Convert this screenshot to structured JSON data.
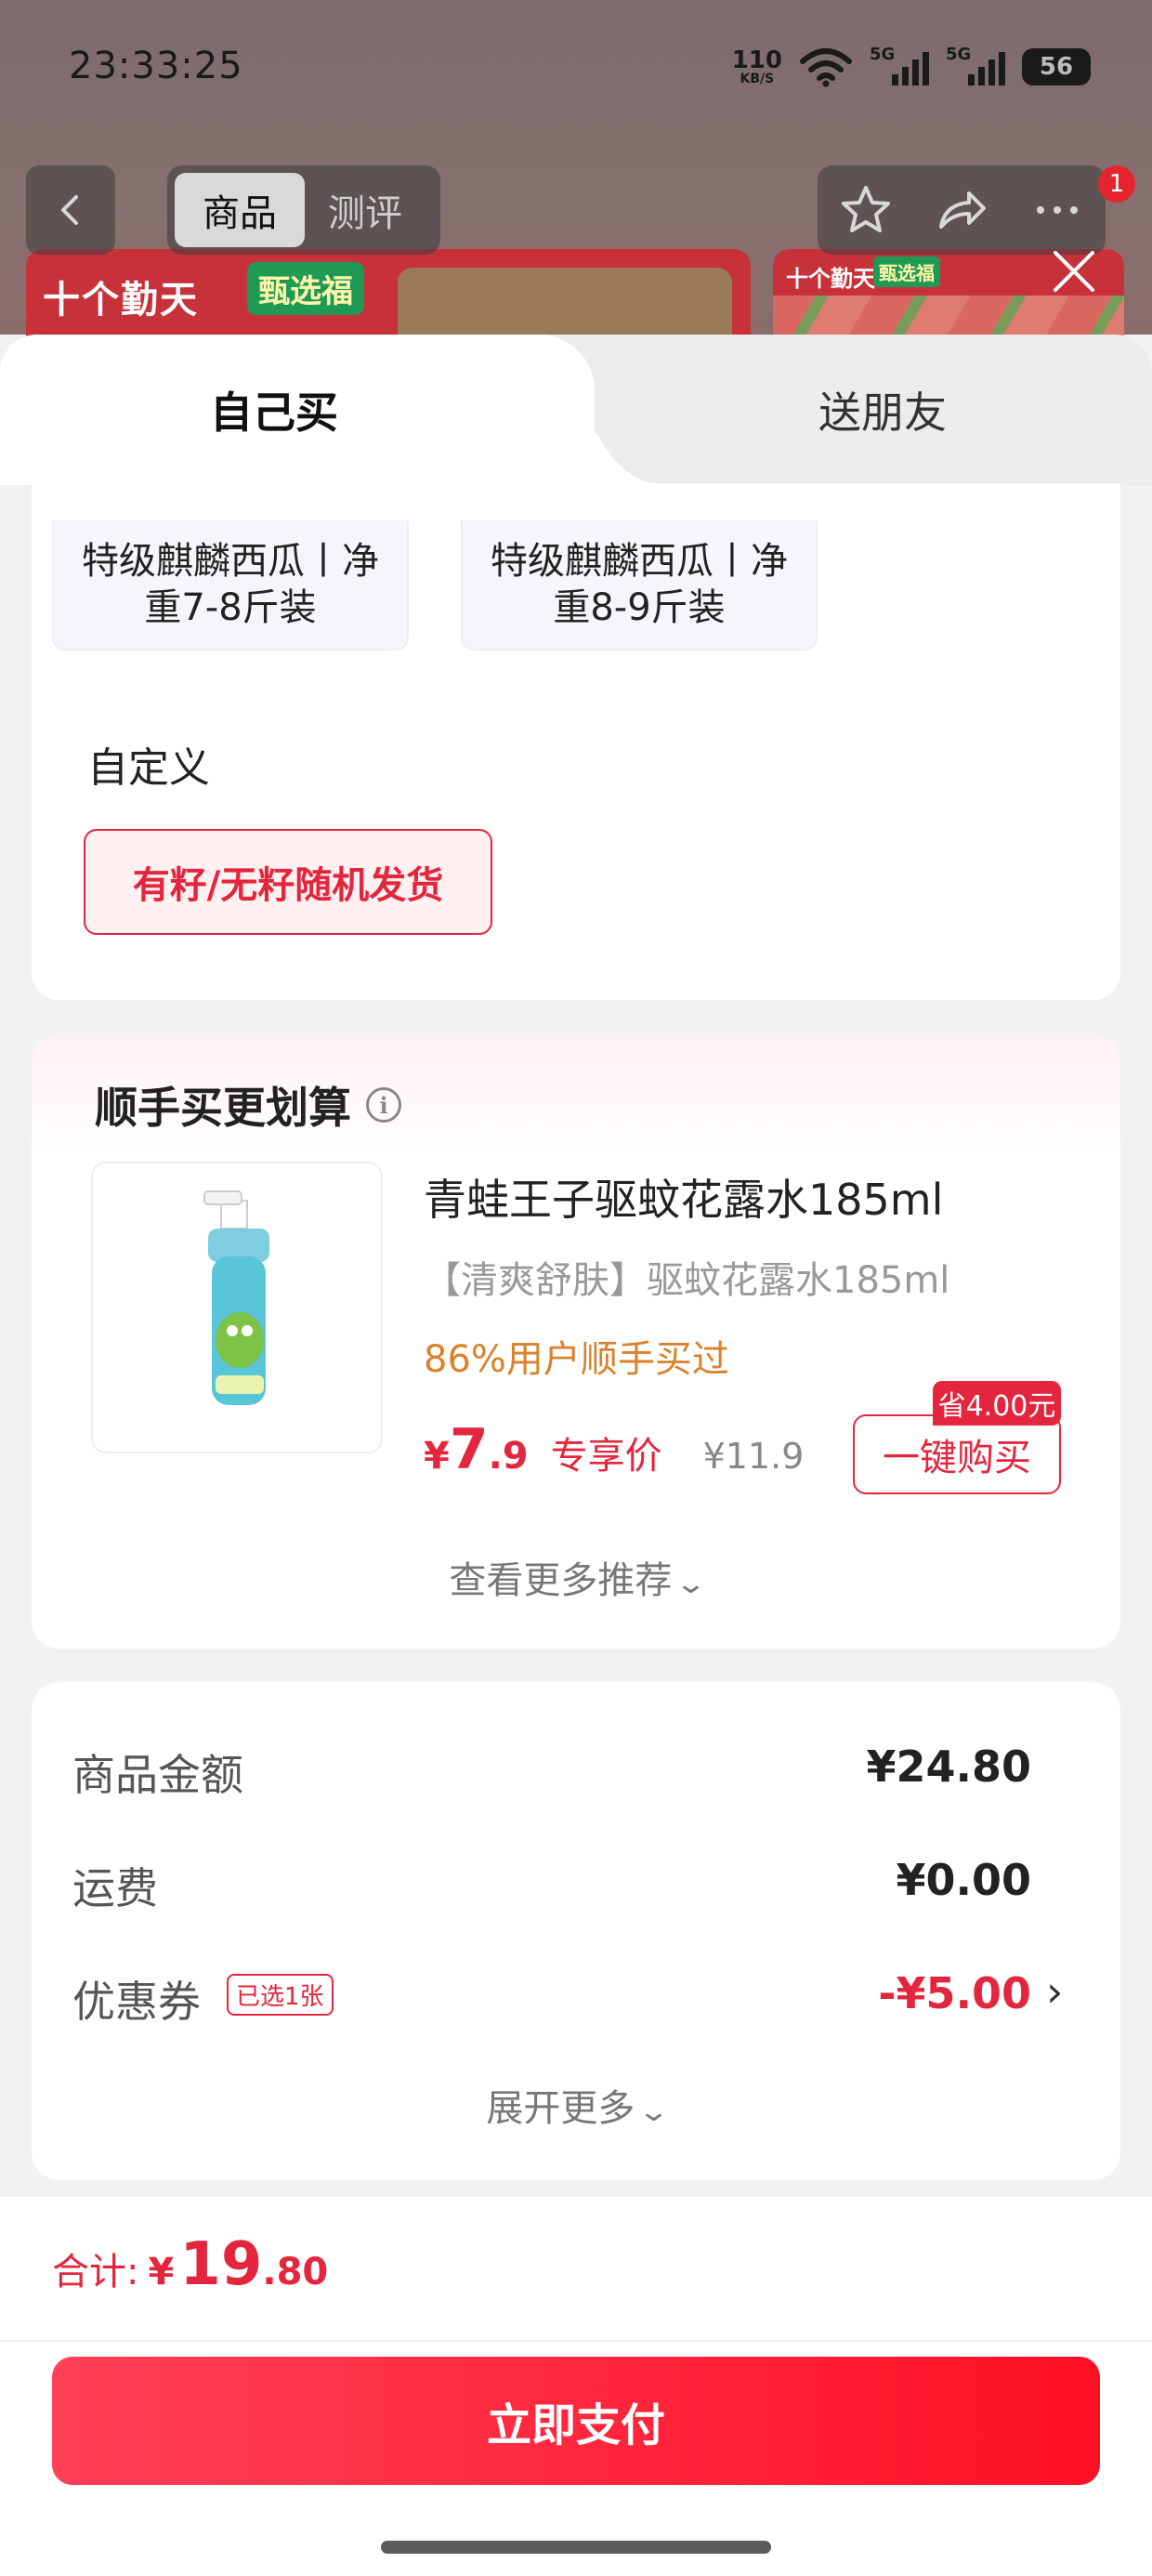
{
  "status_bar": {
    "time": "23:33:25",
    "net_speed_value": "110",
    "net_speed_unit": "KB/S",
    "signal1_label": "5G",
    "signal2_label": "5G",
    "battery": "56"
  },
  "top_nav": {
    "tab_goods": "商品",
    "tab_review": "测评",
    "badge_count": "1",
    "icons": [
      "back-icon",
      "star-icon",
      "share-icon",
      "more-icon",
      "close-icon"
    ]
  },
  "banner": {
    "brand_text": "十个勤天",
    "brand_tag": "甄选福",
    "brand_text_small": "十个勤天",
    "brand_tag_small": "甄选福"
  },
  "sheet": {
    "tab_self": "自己买",
    "tab_friend": "送朋友"
  },
  "spec": {
    "options": [
      {
        "label": "特级麒麟西瓜丨净重7-8斤装"
      },
      {
        "label": "特级麒麟西瓜丨净重8-9斤装"
      }
    ],
    "custom_title": "自定义",
    "custom_option": "有籽/无籽随机发货"
  },
  "recommend": {
    "title": "顺手买更划算",
    "product_name": "青蛙王子驱蚊花露水185ml",
    "product_subtitle": "【清爽舒肤】驱蚊花露水185ml",
    "social_proof": "86%用户顺手买过",
    "price_symbol": "¥",
    "price_int": "7",
    "price_dec": ".9",
    "price_tag": "专享价",
    "original_price": "¥11.9",
    "buy_button": "一键购买",
    "save_badge": "省4.00元",
    "more_link": "查看更多推荐"
  },
  "summary": {
    "rows": [
      {
        "label": "商品金额",
        "value": "¥24.80"
      },
      {
        "label": "运费",
        "value": "¥0.00"
      },
      {
        "label": "优惠券",
        "value": "-¥5.00"
      }
    ],
    "coupon_tag": "已选1张",
    "expand_more": "展开更多"
  },
  "footer": {
    "total_label": "合计:",
    "total_symbol": "¥",
    "total_int": "19",
    "total_dec": ".80",
    "pay_button": "立即支付"
  },
  "colors": {
    "accent_red": "#e3263d",
    "orange": "#d9822b",
    "pay_gradient_start": "#ff4057",
    "pay_gradient_end": "#ff1024"
  }
}
